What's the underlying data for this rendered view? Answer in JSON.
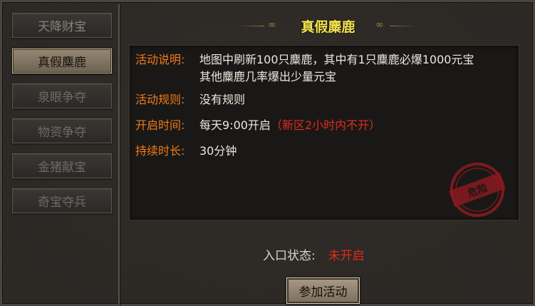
{
  "sidebar": {
    "items": [
      {
        "label": "天降财宝",
        "state": "normal"
      },
      {
        "label": "真假麋鹿",
        "state": "active"
      },
      {
        "label": "泉眼争夺",
        "state": "disabled"
      },
      {
        "label": "物资争夺",
        "state": "disabled"
      },
      {
        "label": "金猪献宝",
        "state": "disabled"
      },
      {
        "label": "奇宝夺兵",
        "state": "disabled"
      }
    ]
  },
  "header": {
    "title": "真假麋鹿"
  },
  "details": {
    "description_label": "活动说明:",
    "description_line1": "地图中刷新100只麋鹿，其中有1只麋鹿必爆1000元宝",
    "description_line2": "其他麋鹿几率爆出少量元宝",
    "rules_label": "活动规则:",
    "rules_value": "没有规则",
    "open_time_label": "开启时间:",
    "open_time_value": "每天9:00开启",
    "open_time_note": "（新区2小时内不开）",
    "duration_label": "持续时长:",
    "duration_value": "30分钟"
  },
  "stamp": {
    "text": "危险",
    "color": "#8a1a1f"
  },
  "entry": {
    "label": "入口状态:",
    "status": "未开启"
  },
  "join_button": {
    "label": "参加活动"
  },
  "colors": {
    "label_orange": "#ef7a1a",
    "title_yellow": "#f3e34f",
    "status_red": "#e22a1f"
  }
}
